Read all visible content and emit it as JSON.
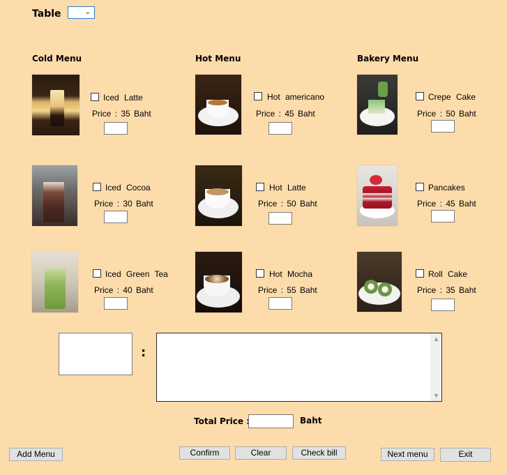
{
  "header": {
    "table_label": "Table",
    "table_value": ""
  },
  "sections": {
    "cold": "Cold Menu",
    "hot": "Hot Menu",
    "bakery": "Bakery Menu"
  },
  "items": {
    "iced_latte": {
      "name": "Iced  Latte",
      "price": "Price :  35 Baht"
    },
    "iced_cocoa": {
      "name": "Iced  Cocoa",
      "price": "Price :  30 Baht"
    },
    "iced_green_tea": {
      "name": "Iced  Green Tea",
      "price": "Price :  40 Baht"
    },
    "hot_americano": {
      "name": "Hot  americano",
      "price": "Price :  45 Baht"
    },
    "hot_latte": {
      "name": "Hot  Latte",
      "price": "Price :  50 Baht"
    },
    "hot_mocha": {
      "name": "Hot  Mocha",
      "price": "Price :  55 Baht"
    },
    "crepe_cake": {
      "name": "Crepe  Cake",
      "price": "Price :  50 Baht"
    },
    "pancakes": {
      "name": "Pancakes",
      "price": "Price :  45 Baht"
    },
    "roll_cake": {
      "name": "Roll  Cake",
      "price": "Price :  35 Baht"
    }
  },
  "order": {
    "colon": ":"
  },
  "total": {
    "label": "Total  Price  :",
    "value": "",
    "unit": "Baht"
  },
  "buttons": {
    "add_menu": "Add Menu",
    "confirm": "Confirm",
    "clear": "Clear",
    "check_bill": "Check bill",
    "next_menu": "Next menu",
    "exit": "Exit"
  },
  "icons": {
    "dropdown": "chevron-down-icon",
    "scroll_up": "scroll-up-icon",
    "scroll_down": "scroll-down-icon"
  }
}
